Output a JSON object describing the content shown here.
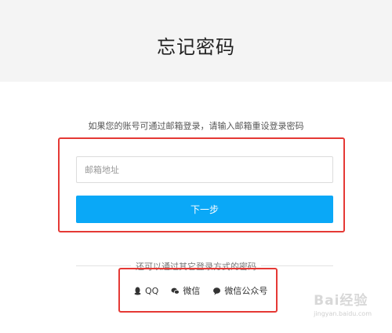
{
  "header": {
    "title": "忘记密码"
  },
  "form": {
    "hint": "如果您的账号可通过邮箱登录，请输入邮箱重设登录密码",
    "email_value": "",
    "email_placeholder": "邮箱地址",
    "next_label": "下一步"
  },
  "alternatives": {
    "text": "还可以通过其它登录方式的密码",
    "items": [
      {
        "label": "QQ",
        "icon": "qq-icon"
      },
      {
        "label": "微信",
        "icon": "wechat-icon"
      },
      {
        "label": "微信公众号",
        "icon": "wechat-official-account-icon"
      }
    ]
  },
  "watermark": {
    "brand": "Bai经验",
    "site": "jingyan.baidu.com"
  },
  "colors": {
    "primary_button": "#0aa8f7",
    "highlight_border": "#e53935",
    "header_bg": "#f4f4f4"
  }
}
